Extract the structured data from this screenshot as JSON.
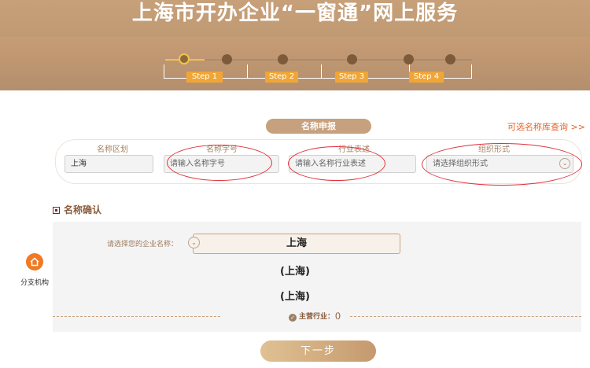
{
  "header": {
    "title": "上海市开办企业“一窗通”网上服务",
    "steps": [
      "Step 1",
      "Step 2",
      "Step 3",
      "Step 4"
    ],
    "active_step": 1
  },
  "name_application": {
    "title": "名称申报",
    "optional_link": "可选名称库查询 >>",
    "columns": {
      "region": {
        "label": "名称区划",
        "value": "上海"
      },
      "brand": {
        "label": "名称字号",
        "placeholder": "请输入名称字号"
      },
      "industry": {
        "label": "行业表述",
        "placeholder": "请输入名称行业表述"
      },
      "org_form": {
        "label": "组织形式",
        "placeholder": "请选择组织形式"
      }
    }
  },
  "confirmation": {
    "title": "名称确认",
    "select_label": "请选择您的企业名称：",
    "selected_name": "上海",
    "options": [
      "(上海)",
      "(上海)"
    ],
    "main_industry_label": "主营行业：（）"
  },
  "actions": {
    "next": "下一步"
  },
  "branch": {
    "label": "分支机构"
  },
  "colors": {
    "header": "#c9a27a",
    "accent": "#f0a636",
    "link": "#e6632a",
    "annotation": "#e0303a",
    "branch": "#f07a23"
  },
  "icons": [
    "home-icon",
    "chevron-down-icon",
    "check-circle-icon"
  ]
}
